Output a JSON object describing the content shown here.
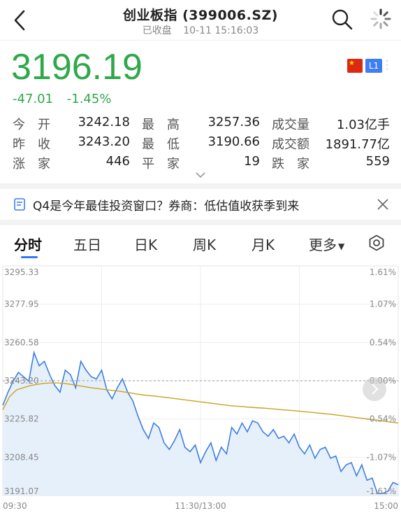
{
  "header": {
    "title": "创业板指 (399006.SZ)",
    "status": "已收盘",
    "timestamp": "10-11 15:16:03",
    "icons": {
      "back": "back-chevron-icon",
      "search": "search-icon",
      "loading": "loading-spinner-icon"
    }
  },
  "quote": {
    "price": "3196.19",
    "change": "-47.01",
    "change_pct": "-1.45%",
    "price_color": "#2fa84a",
    "badge_l1": "L1",
    "flag": "china-flag-icon"
  },
  "stats": [
    [
      {
        "label": "今开",
        "value": "3242.18"
      },
      {
        "label": "最高",
        "value": "3257.36"
      },
      {
        "label": "成交量",
        "value": "1.03亿手"
      }
    ],
    [
      {
        "label": "昨收",
        "value": "3243.20"
      },
      {
        "label": "最低",
        "value": "3190.66"
      },
      {
        "label": "成交额",
        "value": "1891.77亿"
      }
    ],
    [
      {
        "label": "涨家",
        "value": "446"
      },
      {
        "label": "平家",
        "value": "19"
      },
      {
        "label": "跌家",
        "value": "559"
      }
    ]
  ],
  "news": {
    "text": "Q4是今年最佳投资窗口？券商：低估值收获季到来"
  },
  "tabs": [
    {
      "label": "分时",
      "active": true
    },
    {
      "label": "五日"
    },
    {
      "label": "日K"
    },
    {
      "label": "周K"
    },
    {
      "label": "月K"
    },
    {
      "label": "更多"
    }
  ],
  "chart_data": {
    "type": "line",
    "x_labels": [
      "09:30",
      "11:30/13:00",
      "15:00"
    ],
    "y_left": [
      "3295.33",
      "3277.95",
      "3260.58",
      "3243.20",
      "3225.82",
      "3208.45",
      "3191.07"
    ],
    "y_right": [
      "1.61%",
      "1.07%",
      "0.54%",
      "0.00%",
      "-0.54%",
      "-1.07%",
      "-1.61%"
    ],
    "ylim": [
      3191.07,
      3295.33
    ],
    "prev_close": 3243.2,
    "series": [
      {
        "color": "#3d7fe0",
        "values": [
          3232,
          3238,
          3243,
          3247,
          3245,
          3243,
          3256,
          3250,
          3252,
          3246,
          3241,
          3238,
          3248,
          3246,
          3240,
          3252,
          3248,
          3245,
          3244,
          3248,
          3239,
          3235,
          3240,
          3244,
          3238,
          3234,
          3227,
          3221,
          3217,
          3224,
          3222,
          3215,
          3212,
          3216,
          3221,
          3213,
          3211,
          3214,
          3206,
          3211,
          3215,
          3207,
          3213,
          3210,
          3222,
          3219,
          3224,
          3220,
          3225,
          3224,
          3220,
          3218,
          3221,
          3217,
          3218,
          3215,
          3219,
          3213,
          3210,
          3214,
          3208,
          3212,
          3213,
          3208,
          3209,
          3202,
          3205,
          3206,
          3200,
          3205,
          3198,
          3199,
          3192,
          3192,
          3193,
          3197,
          3196
        ]
      },
      {
        "color": "#c9a31a",
        "values": [
          3230,
          3236,
          3239,
          3240,
          3241,
          3241.5,
          3242,
          3242.2,
          3242.2,
          3242,
          3241.5,
          3241,
          3240.5,
          3240,
          3239.6,
          3239.2,
          3238.8,
          3238.5,
          3238,
          3237.5,
          3237,
          3236.6,
          3236.3,
          3236,
          3235.6,
          3235.2,
          3234.8,
          3234.4,
          3234,
          3233.6,
          3233.2,
          3232.8,
          3232.4,
          3232,
          3231.7,
          3231.5,
          3231.2,
          3231,
          3230.8,
          3230.6,
          3230.3,
          3230,
          3229.8,
          3229.5,
          3229.2,
          3228.9,
          3228.6,
          3228.3,
          3228,
          3227.6,
          3227.2,
          3226.8,
          3226.4,
          3226,
          3225.6,
          3225.2,
          3224.8,
          3224.4,
          3224
        ]
      }
    ]
  }
}
